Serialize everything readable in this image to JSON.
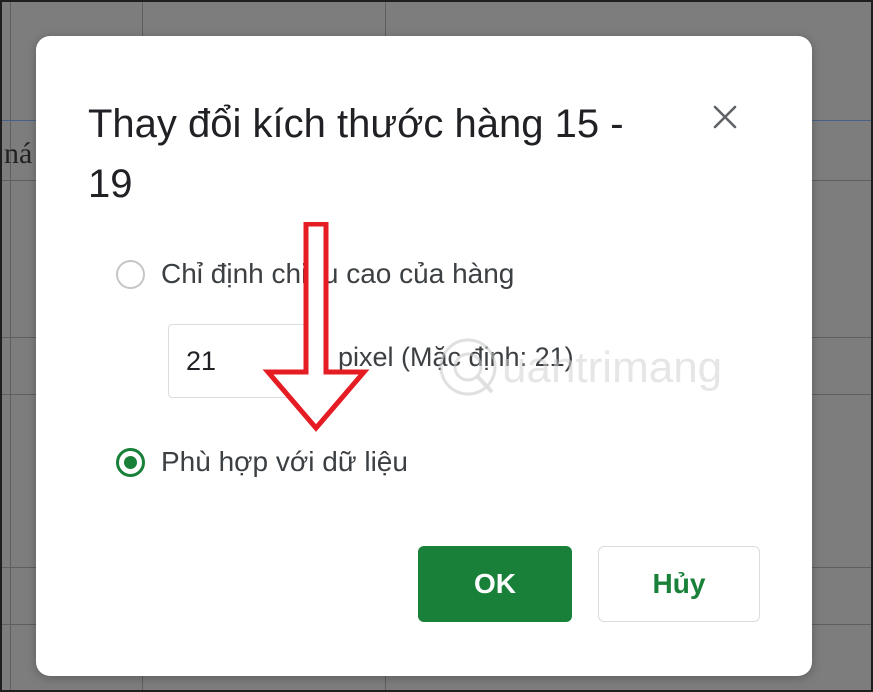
{
  "background": {
    "sheet_fragment": "ná"
  },
  "dialog": {
    "title": "Thay đổi kích thước hàng 15 - 19",
    "close_icon": "close-icon",
    "option_specify_label": "Chỉ định chiều cao của hàng",
    "option_specify_selected": false,
    "row_height_value": "21",
    "pixel_hint": "pixel (Mặc định: 21)",
    "option_fit_label": "Phù hợp với dữ liệu",
    "option_fit_selected": true,
    "ok_label": "OK",
    "cancel_label": "Hủy"
  },
  "watermark": {
    "text": "uantrimang"
  },
  "colors": {
    "accent_green": "#188038",
    "annotation_red": "#e51c23",
    "overlay_gray": "#7d7d7d"
  }
}
